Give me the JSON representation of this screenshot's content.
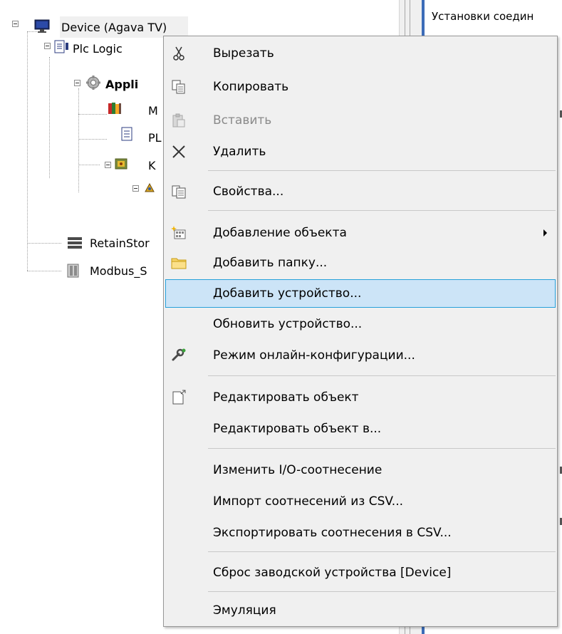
{
  "tree": {
    "items": [
      {
        "label": "Device (Agava TV)",
        "icon": "device-monitor-icon"
      },
      {
        "label": "Plc Logic",
        "icon": "plc-logic-icon"
      },
      {
        "label": "Appli",
        "icon": "application-gear-icon"
      },
      {
        "label": "M",
        "icon": "library-books-icon"
      },
      {
        "label": "PL",
        "icon": "document-icon"
      },
      {
        "label": "K",
        "icon": "task-config-icon"
      },
      {
        "label": "",
        "icon": "task-icon"
      },
      {
        "label": "RetainStor",
        "icon": "retain-storage-icon"
      },
      {
        "label": "Modbus_S",
        "icon": "modbus-device-icon"
      }
    ]
  },
  "editor": {
    "tab_label": "Установки соедин"
  },
  "context_menu": {
    "items": [
      {
        "label": "Вырезать",
        "icon": "scissors-icon"
      },
      {
        "label": "Копировать",
        "icon": "copy-icon"
      },
      {
        "label": "Вставить",
        "icon": "paste-icon",
        "disabled": true
      },
      {
        "label": "Удалить",
        "icon": "delete-x-icon"
      },
      {
        "label": "Свойства...",
        "icon": "properties-icon"
      },
      {
        "label": "Добавление объекта",
        "icon": "add-object-icon",
        "submenu": true
      },
      {
        "label": "Добавить папку...",
        "icon": "folder-icon"
      },
      {
        "label": "Добавить устройство...",
        "icon": "",
        "highlighted": true
      },
      {
        "label": "Обновить устройство...",
        "icon": ""
      },
      {
        "label": "Режим онлайн-конфигурации...",
        "icon": "online-config-wrench-icon"
      },
      {
        "label": "Редактировать объект",
        "icon": "edit-object-icon"
      },
      {
        "label": "Редактировать объект в...",
        "icon": ""
      },
      {
        "label": "Изменить I/O-соотнесение",
        "icon": ""
      },
      {
        "label": "Импорт соотнесений из CSV...",
        "icon": ""
      },
      {
        "label": "Экспортировать соотнесения в CSV...",
        "icon": ""
      },
      {
        "label": "Сброс заводской устройства [Device]",
        "icon": ""
      },
      {
        "label": "Эмуляция",
        "icon": ""
      }
    ]
  },
  "colors": {
    "menu_background": "#f0f0f0",
    "menu_highlight": "#cce4f7",
    "menu_highlight_border": "#26a0da",
    "disabled_text": "#8a8a8a",
    "editor_accent": "#3c6cb8"
  }
}
